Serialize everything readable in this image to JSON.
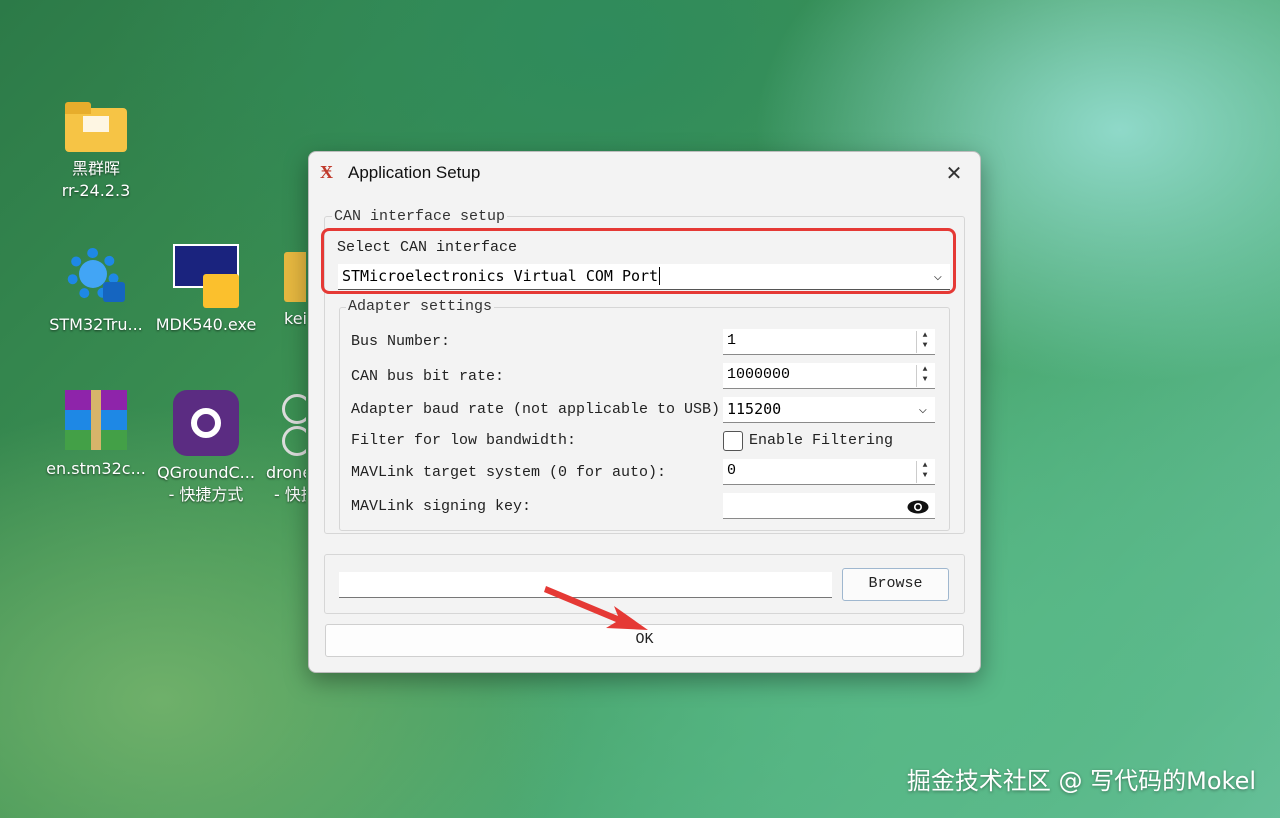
{
  "desktop": {
    "icons": [
      {
        "label": "黑群晖",
        "label2": "rr-24.2.3"
      },
      {
        "label": "STM32Tru..."
      },
      {
        "label": "MDK540.exe"
      },
      {
        "label": "kei"
      },
      {
        "label": "en.stm32c..."
      },
      {
        "label": "QGroundC...",
        "label2": "- 快捷方式"
      },
      {
        "label": "drone",
        "label2": "- 快捷"
      }
    ]
  },
  "dialog": {
    "title": "Application Setup",
    "can_group_label": "CAN interface setup",
    "select_label": "Select CAN interface",
    "selected_interface": "STMicroelectronics Virtual COM Port",
    "adapter_group_label": "Adapter settings",
    "rows": {
      "bus_number_label": "Bus Number:",
      "bus_number_value": "1",
      "bitrate_label": "CAN bus bit rate:",
      "bitrate_value": "1000000",
      "baud_label": "Adapter baud rate (not applicable to USB):",
      "baud_value": "115200",
      "filter_label": "Filter for low bandwidth:",
      "filter_checkbox_label": "Enable Filtering",
      "mavlink_target_label": "MAVLink target system (0 for auto):",
      "mavlink_target_value": "0",
      "signing_label": "MAVLink signing key:",
      "signing_value": ""
    },
    "browse_path": "",
    "browse_label": "Browse",
    "ok_label": "OK"
  },
  "watermark": "掘金技术社区 @ 写代码的Mokel",
  "colors": {
    "highlight": "#e53935",
    "arrow": "#e53935"
  }
}
